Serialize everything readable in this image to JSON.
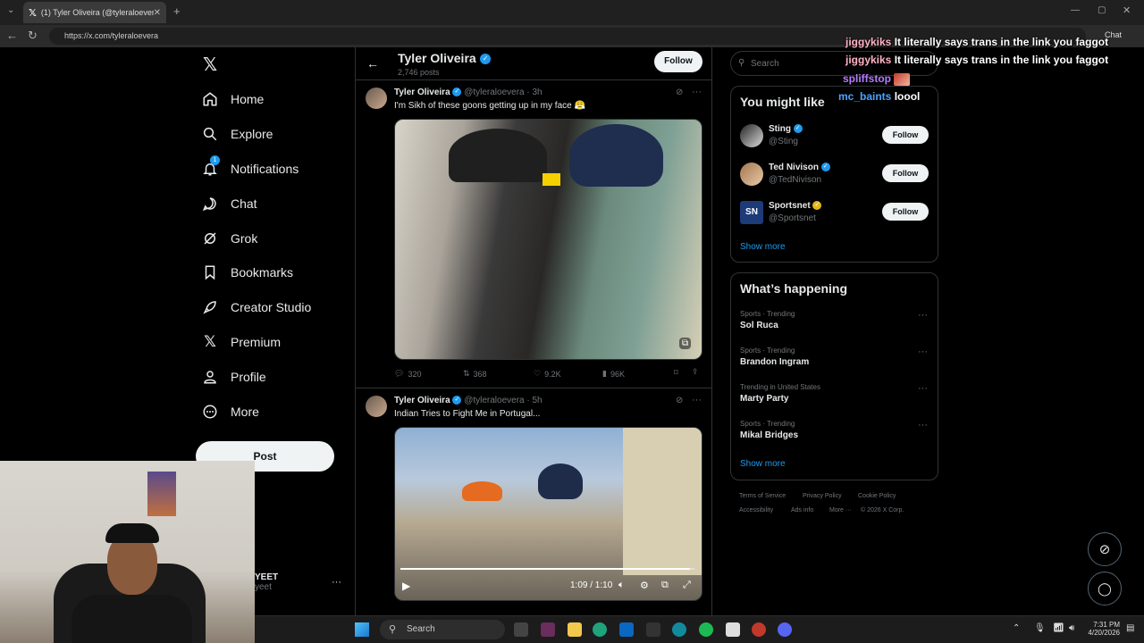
{
  "browser": {
    "tab_title": "(1) Tyler Oliveira (@tyleraloevera) / X",
    "url": "https://x.com/tyleraloevera",
    "chat_label": "Chat"
  },
  "nav": {
    "items": [
      {
        "label": "Home",
        "icon": "home-icon"
      },
      {
        "label": "Explore",
        "icon": "search-icon"
      },
      {
        "label": "Notifications",
        "icon": "bell-icon",
        "badge": "1"
      },
      {
        "label": "Chat",
        "icon": "chat-icon"
      },
      {
        "label": "Grok",
        "icon": "grok-icon"
      },
      {
        "label": "Bookmarks",
        "icon": "bookmark-icon"
      },
      {
        "label": "Creator Studio",
        "icon": "rocket-icon"
      },
      {
        "label": "Premium",
        "icon": "x-icon"
      },
      {
        "label": "Profile",
        "icon": "person-icon"
      },
      {
        "label": "More",
        "icon": "more-circle-icon"
      }
    ],
    "post_label": "Post",
    "account_name": "YEET",
    "account_handle": "yeet"
  },
  "profile_header": {
    "name": "Tyler Oliveira",
    "post_count": "2,746 posts",
    "follow_label": "Follow"
  },
  "tweets": [
    {
      "name": "Tyler Oliveira",
      "handle": "@tyleraloevera",
      "time": "· 3h",
      "text": "I'm Sikh of these goons getting up in my face 😤",
      "replies": "320",
      "reposts": "368",
      "likes": "9.2K",
      "views": "96K"
    },
    {
      "name": "Tyler Oliveira",
      "handle": "@tyleraloevera",
      "time": "· 5h",
      "text": "Indian Tries to Fight Me in Portugal...",
      "video_time": "1:09 / 1:10",
      "video_progress": 0.985
    }
  ],
  "right": {
    "search_placeholder": "Search",
    "suggestions_title": "You might like",
    "suggestions": [
      {
        "name": "Sting",
        "handle": "@Sting",
        "verified": "blue"
      },
      {
        "name": "Ted Nivison",
        "handle": "@TedNivison",
        "verified": "blue"
      },
      {
        "name": "Sportsnet",
        "handle": "@Sportsnet",
        "verified": "gold"
      }
    ],
    "follow_label": "Follow",
    "show_more": "Show more",
    "trends_title": "What’s happening",
    "trends": [
      {
        "meta": "Sports · Trending",
        "name": "Sol Ruca"
      },
      {
        "meta": "Sports · Trending",
        "name": "Brandon Ingram"
      },
      {
        "meta": "Trending in United States",
        "name": "Marty Party"
      },
      {
        "meta": "Sports · Trending",
        "name": "Mikal Bridges"
      }
    ],
    "footer": [
      "Terms of Service",
      "Privacy Policy",
      "Cookie Policy",
      "Accessibility",
      "Ads info",
      "More ···",
      "© 2026 X Corp."
    ]
  },
  "chat_overlay": [
    {
      "user": "jiggykiks",
      "message": "It literally says trans in the link you faggot",
      "color": "#ffb3c6"
    },
    {
      "user": "jiggykiks",
      "message": "It literally says trans in the link you faggot",
      "color": "#ffb3c6"
    },
    {
      "user": "spliffstop",
      "message": "",
      "color": "#b57cff"
    },
    {
      "user": "mc_baints",
      "message": "loool",
      "color": "#4aa3ff"
    }
  ],
  "taskbar": {
    "search_placeholder": "Search",
    "time": "7:31 PM",
    "date": "4/20/2026"
  }
}
